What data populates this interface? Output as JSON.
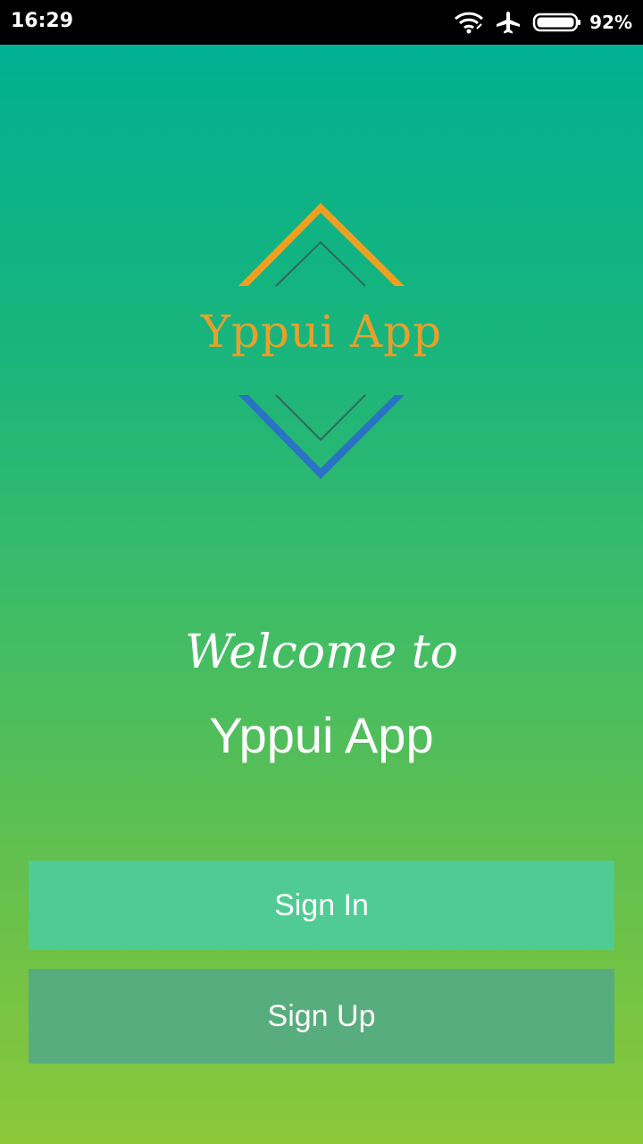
{
  "status_bar": {
    "time": "16:29",
    "battery": "92%",
    "icons": [
      "wifi-icon",
      "airplane-icon",
      "battery-icon"
    ]
  },
  "logo": {
    "text": "Yppui App",
    "colors": {
      "top_chevron": "#f0a020",
      "bottom_chevron": "#2a72c4",
      "inner_lines": "#2e6a5a",
      "text": "#e8a02a"
    }
  },
  "welcome": {
    "script_text": "Welcome to",
    "title": "Yppui App"
  },
  "buttons": {
    "sign_in": "Sign In",
    "sign_up": "Sign Up"
  },
  "colors": {
    "gradient_top": "#00b092",
    "gradient_bottom": "#8cc838",
    "sign_in_bg": "#50cb94",
    "sign_up_bg": "#58ad7e"
  }
}
